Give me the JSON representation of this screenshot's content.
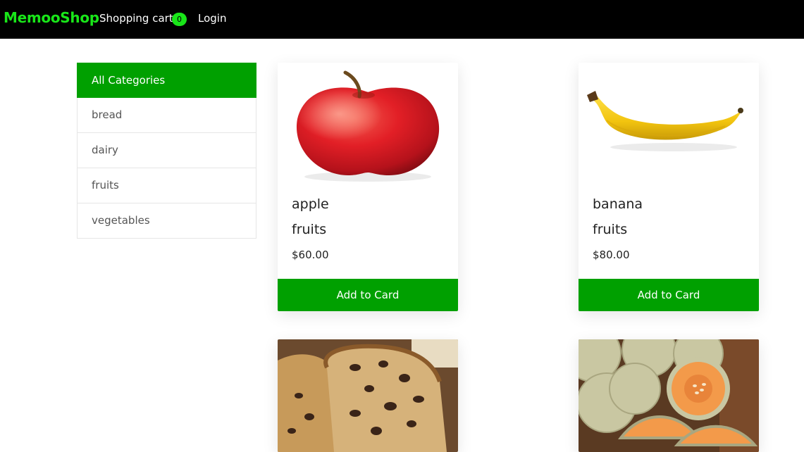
{
  "navbar": {
    "brand": "MemooShop",
    "cart_label": "Shopping cart",
    "cart_count": "0",
    "login_label": "Login"
  },
  "categories": {
    "items": [
      {
        "label": "All Categories",
        "active": true
      },
      {
        "label": "bread",
        "active": false
      },
      {
        "label": "dairy",
        "active": false
      },
      {
        "label": "fruits",
        "active": false
      },
      {
        "label": "vegetables",
        "active": false
      }
    ]
  },
  "products": [
    {
      "name": "apple",
      "category": "fruits",
      "price": "$60.00",
      "button": "Add to Card",
      "image": "apple-image"
    },
    {
      "name": "banana",
      "category": "fruits",
      "price": "$80.00",
      "button": "Add to Card",
      "image": "banana-image"
    },
    {
      "name": "",
      "category": "",
      "price": "",
      "button": "",
      "image": "bread-image"
    },
    {
      "name": "",
      "category": "",
      "price": "",
      "button": "",
      "image": "melon-image"
    }
  ],
  "colors": {
    "brand": "#19e619",
    "accent": "#00a000",
    "navbar_bg": "#000000"
  }
}
